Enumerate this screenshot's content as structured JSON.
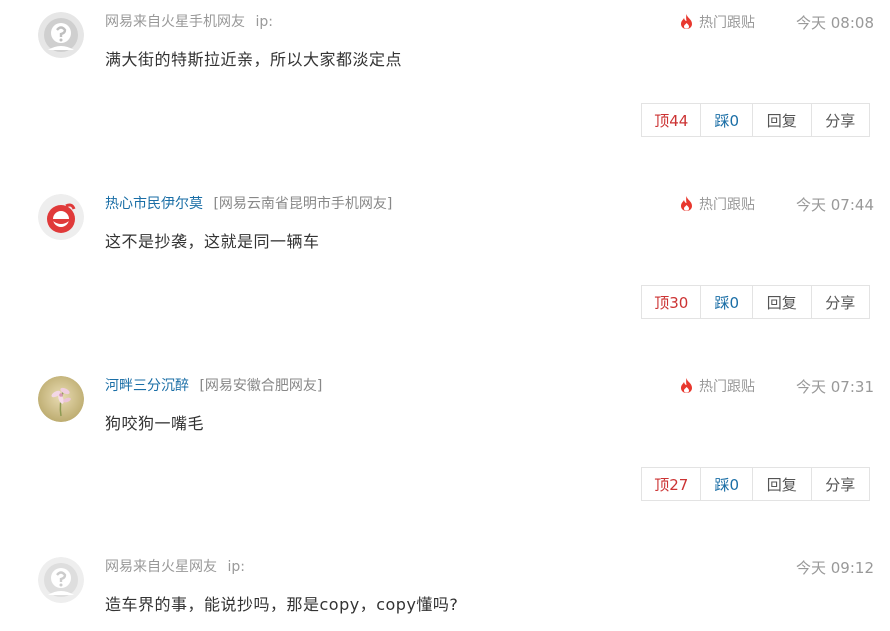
{
  "comments": [
    {
      "author_anon": "网易来自火星手机网友",
      "author_name": "",
      "author_loc": "",
      "ip_label": "ip:",
      "hot_label": "热门跟贴",
      "time": "今天 08:08",
      "body": "满大街的特斯拉近亲，所以大家都淡定点",
      "up_label": "顶44",
      "down_label": "踩0",
      "reply_label": "回复",
      "share_label": "分享",
      "avatar_icon": "anonymous-avatar-icon"
    },
    {
      "author_anon": "",
      "author_name": "热心市民伊尔莫",
      "author_loc": "[网易云南省昆明市手机网友]",
      "ip_label": "",
      "hot_label": "热门跟贴",
      "time": "今天 07:44",
      "body": "这不是抄袭，这就是同一辆车",
      "up_label": "顶30",
      "down_label": "踩0",
      "reply_label": "回复",
      "share_label": "分享",
      "avatar_icon": "red-logo-avatar-icon"
    },
    {
      "author_anon": "",
      "author_name": "河畔三分沉醉",
      "author_loc": "[网易安徽合肥网友]",
      "ip_label": "",
      "hot_label": "热门跟贴",
      "time": "今天 07:31",
      "body": "狗咬狗一嘴毛",
      "up_label": "顶27",
      "down_label": "踩0",
      "reply_label": "回复",
      "share_label": "分享",
      "avatar_icon": "flower-photo-avatar-icon"
    },
    {
      "author_anon": "网易来自火星网友",
      "author_name": "",
      "author_loc": "",
      "ip_label": "ip:",
      "hot_label": "",
      "time": "今天 09:12",
      "body": "造车界的事，能说抄吗，那是copy，copy懂吗?",
      "avatar_icon": "anonymous-avatar-icon"
    }
  ],
  "colors": {
    "hot_fire": "#e8382e",
    "up": "#cc3333",
    "down": "#1a6ea6",
    "author_link": "#1a6ea6"
  }
}
